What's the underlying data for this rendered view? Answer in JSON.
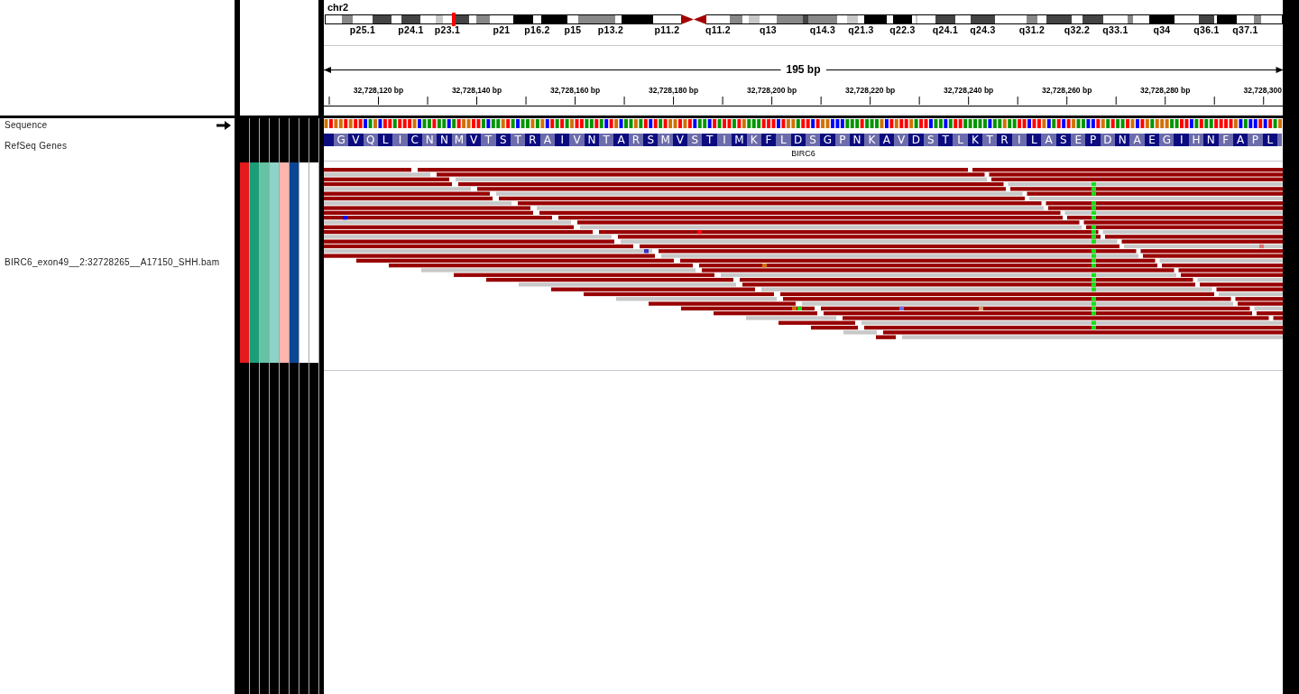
{
  "ideogram": {
    "chromosome": "chr2",
    "bands": [
      {
        "kind": "band",
        "color": "#ffffff"
      },
      {
        "kind": "band",
        "color": "#888888"
      },
      {
        "kind": "band",
        "color": "#ffffff",
        "label": "p25.1"
      },
      {
        "kind": "band",
        "color": "#444444"
      },
      {
        "kind": "band",
        "color": "#ffffff"
      },
      {
        "kind": "band",
        "color": "#444444",
        "label": "p24.1"
      },
      {
        "kind": "band",
        "color": "#ffffff"
      },
      {
        "kind": "band",
        "color": "#c8c8c8"
      },
      {
        "kind": "band",
        "color": "#ffffff",
        "label": "p23.1"
      },
      {
        "kind": "marker",
        "color": "#ff0000"
      },
      {
        "kind": "band",
        "color": "#444444"
      },
      {
        "kind": "band",
        "color": "#ffffff"
      },
      {
        "kind": "band",
        "color": "#888888"
      },
      {
        "kind": "band",
        "color": "#ffffff",
        "label": "p21"
      },
      {
        "kind": "band",
        "color": "#000000"
      },
      {
        "kind": "band",
        "color": "#ffffff",
        "label": "p16.2"
      },
      {
        "kind": "band",
        "color": "#000000"
      },
      {
        "kind": "band",
        "color": "#ffffff",
        "label": "p15"
      },
      {
        "kind": "band",
        "color": "#888888"
      },
      {
        "kind": "band",
        "color": "#888888",
        "label": "p13.2"
      },
      {
        "kind": "band",
        "color": "#ffffff"
      },
      {
        "kind": "band",
        "color": "#000000"
      },
      {
        "kind": "band",
        "color": "#ffffff",
        "label": "p11.2"
      },
      {
        "kind": "centromere",
        "color": "#a50000"
      },
      {
        "kind": "centromere",
        "color": "#a50000"
      },
      {
        "kind": "band",
        "color": "#ffffff",
        "label": "q11.2"
      },
      {
        "kind": "band",
        "color": "#888888"
      },
      {
        "kind": "band",
        "color": "#ffffff"
      },
      {
        "kind": "band",
        "color": "#c8c8c8"
      },
      {
        "kind": "band",
        "color": "#ffffff",
        "label": "q13"
      },
      {
        "kind": "band",
        "color": "#888888"
      },
      {
        "kind": "band",
        "color": "#444444"
      },
      {
        "kind": "band",
        "color": "#888888",
        "label": "q14.3"
      },
      {
        "kind": "band",
        "color": "#ffffff"
      },
      {
        "kind": "band",
        "color": "#c8c8c8"
      },
      {
        "kind": "band",
        "color": "#ffffff",
        "label": "q21.3"
      },
      {
        "kind": "band",
        "color": "#000000"
      },
      {
        "kind": "band",
        "color": "#ffffff"
      },
      {
        "kind": "band",
        "color": "#000000",
        "label": "q22.3"
      },
      {
        "kind": "band",
        "color": "#ffffff"
      },
      {
        "kind": "band",
        "color": "#c8c8c8"
      },
      {
        "kind": "band",
        "color": "#ffffff"
      },
      {
        "kind": "band",
        "color": "#444444",
        "label": "q24.1"
      },
      {
        "kind": "band",
        "color": "#ffffff"
      },
      {
        "kind": "band",
        "color": "#444444",
        "label": "q24.3"
      },
      {
        "kind": "band",
        "color": "#ffffff"
      },
      {
        "kind": "band",
        "color": "#888888",
        "label": "q31.2"
      },
      {
        "kind": "band",
        "color": "#ffffff"
      },
      {
        "kind": "band",
        "color": "#444444"
      },
      {
        "kind": "band",
        "color": "#ffffff",
        "label": "q32.2"
      },
      {
        "kind": "band",
        "color": "#444444"
      },
      {
        "kind": "band",
        "color": "#ffffff",
        "label": "q33.1"
      },
      {
        "kind": "band",
        "color": "#888888"
      },
      {
        "kind": "band",
        "color": "#ffffff"
      },
      {
        "kind": "band",
        "color": "#000000",
        "label": "q34"
      },
      {
        "kind": "band",
        "color": "#ffffff"
      },
      {
        "kind": "band",
        "color": "#444444",
        "label": "q36.1"
      },
      {
        "kind": "band",
        "color": "#ffffff"
      },
      {
        "kind": "band",
        "color": "#000000"
      },
      {
        "kind": "band",
        "color": "#ffffff",
        "label": "q37.1"
      },
      {
        "kind": "band",
        "color": "#888888"
      },
      {
        "kind": "band",
        "color": "#ffffff"
      }
    ]
  },
  "ruler": {
    "span": "195 bp",
    "tick_labels": [
      "32,728,120 bp",
      "32,728,140 bp",
      "32,728,160 bp",
      "32,728,180 bp",
      "32,728,200 bp",
      "32,728,220 bp",
      "32,728,240 bp",
      "32,728,260 bp",
      "32,728,280 bp",
      "32,728,300"
    ]
  },
  "tracks": [
    {
      "kind": "sequence",
      "name": "Sequence",
      "forward_strand": true,
      "bases": [
        {
          "color": "#d17105"
        },
        {
          "color": "#ff0000"
        },
        {
          "color": "#d17105"
        },
        {
          "color": "#d17105"
        },
        {
          "color": "#ff0000"
        },
        {
          "color": "#d17105"
        },
        {
          "color": "#ff0000"
        },
        {
          "color": "#ff0000"
        },
        {
          "color": "#0000ff"
        },
        {
          "color": "#009600"
        },
        {
          "color": "#d17105"
        },
        {
          "color": "#0000ff"
        },
        {
          "color": "#ff0000"
        },
        {
          "color": "#ff0000"
        },
        {
          "color": "#009600"
        },
        {
          "color": "#ff0000"
        },
        {
          "color": "#ff0000"
        },
        {
          "color": "#ff0000"
        },
        {
          "color": "#d17105"
        },
        {
          "color": "#0000ff"
        },
        {
          "color": "#009600"
        },
        {
          "color": "#009600"
        },
        {
          "color": "#ff0000"
        },
        {
          "color": "#009600"
        },
        {
          "color": "#009600"
        },
        {
          "color": "#0000ff"
        },
        {
          "color": "#009600"
        },
        {
          "color": "#ff0000"
        },
        {
          "color": "#d17105"
        },
        {
          "color": "#d17105"
        },
        {
          "color": "#ff0000"
        },
        {
          "color": "#ff0000"
        },
        {
          "color": "#009600"
        },
        {
          "color": "#0000ff"
        },
        {
          "color": "#009600"
        },
        {
          "color": "#009600"
        },
        {
          "color": "#d17105"
        },
        {
          "color": "#ff0000"
        },
        {
          "color": "#009600"
        },
        {
          "color": "#0000ff"
        },
        {
          "color": "#009600"
        },
        {
          "color": "#009600"
        },
        {
          "color": "#d17105"
        },
        {
          "color": "#009600"
        },
        {
          "color": "#d17105"
        },
        {
          "color": "#0000ff"
        },
        {
          "color": "#ff0000"
        },
        {
          "color": "#009600"
        },
        {
          "color": "#ff0000"
        },
        {
          "color": "#009600"
        },
        {
          "color": "#d17105"
        },
        {
          "color": "#ff0000"
        },
        {
          "color": "#ff0000"
        },
        {
          "color": "#009600"
        },
        {
          "color": "#009600"
        },
        {
          "color": "#ff0000"
        },
        {
          "color": "#009600"
        },
        {
          "color": "#0000ff"
        },
        {
          "color": "#ff0000"
        },
        {
          "color": "#d17105"
        },
        {
          "color": "#0000ff"
        },
        {
          "color": "#009600"
        },
        {
          "color": "#009600"
        },
        {
          "color": "#d17105"
        },
        {
          "color": "#009600"
        },
        {
          "color": "#ff0000"
        },
        {
          "color": "#0000ff"
        },
        {
          "color": "#ff0000"
        },
        {
          "color": "#009600"
        },
        {
          "color": "#ff0000"
        },
        {
          "color": "#d17105"
        },
        {
          "color": "#d17105"
        },
        {
          "color": "#ff0000"
        },
        {
          "color": "#d17105"
        },
        {
          "color": "#ff0000"
        },
        {
          "color": "#0000ff"
        },
        {
          "color": "#009600"
        },
        {
          "color": "#009600"
        },
        {
          "color": "#0000ff"
        },
        {
          "color": "#ff0000"
        },
        {
          "color": "#009600"
        },
        {
          "color": "#ff0000"
        },
        {
          "color": "#ff0000"
        },
        {
          "color": "#009600"
        },
        {
          "color": "#ff0000"
        },
        {
          "color": "#d17105"
        },
        {
          "color": "#009600"
        },
        {
          "color": "#009600"
        },
        {
          "color": "#009600"
        },
        {
          "color": "#ff0000"
        },
        {
          "color": "#ff0000"
        },
        {
          "color": "#ff0000"
        },
        {
          "color": "#0000ff"
        },
        {
          "color": "#ff0000"
        },
        {
          "color": "#d17105"
        },
        {
          "color": "#d17105"
        },
        {
          "color": "#009600"
        },
        {
          "color": "#ff0000"
        },
        {
          "color": "#ff0000"
        },
        {
          "color": "#0000ff"
        },
        {
          "color": "#ff0000"
        },
        {
          "color": "#d17105"
        },
        {
          "color": "#d17105"
        },
        {
          "color": "#0000ff"
        },
        {
          "color": "#0000ff"
        },
        {
          "color": "#0000ff"
        },
        {
          "color": "#009600"
        },
        {
          "color": "#009600"
        },
        {
          "color": "#009600"
        },
        {
          "color": "#ff0000"
        },
        {
          "color": "#009600"
        },
        {
          "color": "#009600"
        },
        {
          "color": "#009600"
        },
        {
          "color": "#d17105"
        },
        {
          "color": "#0000ff"
        },
        {
          "color": "#ff0000"
        },
        {
          "color": "#d17105"
        },
        {
          "color": "#ff0000"
        },
        {
          "color": "#ff0000"
        },
        {
          "color": "#d17105"
        },
        {
          "color": "#009600"
        },
        {
          "color": "#ff0000"
        },
        {
          "color": "#ff0000"
        },
        {
          "color": "#0000ff"
        },
        {
          "color": "#009600"
        },
        {
          "color": "#009600"
        },
        {
          "color": "#0000ff"
        },
        {
          "color": "#009600"
        },
        {
          "color": "#ff0000"
        },
        {
          "color": "#ff0000"
        },
        {
          "color": "#009600"
        },
        {
          "color": "#009600"
        },
        {
          "color": "#009600"
        },
        {
          "color": "#009600"
        },
        {
          "color": "#009600"
        },
        {
          "color": "#0000ff"
        },
        {
          "color": "#009600"
        },
        {
          "color": "#009600"
        },
        {
          "color": "#d17105"
        },
        {
          "color": "#009600"
        },
        {
          "color": "#009600"
        },
        {
          "color": "#ff0000"
        },
        {
          "color": "#ff0000"
        },
        {
          "color": "#0000ff"
        },
        {
          "color": "#ff0000"
        },
        {
          "color": "#ff0000"
        },
        {
          "color": "#d17105"
        },
        {
          "color": "#0000ff"
        },
        {
          "color": "#009600"
        },
        {
          "color": "#ff0000"
        },
        {
          "color": "#0000ff"
        },
        {
          "color": "#ff0000"
        },
        {
          "color": "#d17105"
        },
        {
          "color": "#009600"
        },
        {
          "color": "#009600"
        },
        {
          "color": "#0000ff"
        },
        {
          "color": "#0000ff"
        },
        {
          "color": "#ff0000"
        },
        {
          "color": "#d17105"
        },
        {
          "color": "#009600"
        },
        {
          "color": "#ff0000"
        },
        {
          "color": "#009600"
        },
        {
          "color": "#009600"
        },
        {
          "color": "#ff0000"
        },
        {
          "color": "#d17105"
        },
        {
          "color": "#0000ff"
        },
        {
          "color": "#ff0000"
        },
        {
          "color": "#d17105"
        },
        {
          "color": "#009600"
        },
        {
          "color": "#d17105"
        },
        {
          "color": "#d17105"
        },
        {
          "color": "#d17105"
        },
        {
          "color": "#009600"
        },
        {
          "color": "#009600"
        },
        {
          "color": "#ff0000"
        },
        {
          "color": "#ff0000"
        },
        {
          "color": "#0000ff"
        },
        {
          "color": "#009600"
        },
        {
          "color": "#ff0000"
        },
        {
          "color": "#009600"
        },
        {
          "color": "#009600"
        },
        {
          "color": "#ff0000"
        },
        {
          "color": "#ff0000"
        },
        {
          "color": "#ff0000"
        },
        {
          "color": "#ff0000"
        },
        {
          "color": "#d17105"
        },
        {
          "color": "#0000ff"
        },
        {
          "color": "#009600"
        },
        {
          "color": "#0000ff"
        },
        {
          "color": "#0000ff"
        },
        {
          "color": "#ff0000"
        },
        {
          "color": "#0000ff"
        },
        {
          "color": "#ff0000"
        },
        {
          "color": "#009600"
        },
        {
          "color": "#d17105"
        }
      ]
    },
    {
      "kind": "gene",
      "name": "RefSeq Genes",
      "gene": "BIRC6",
      "amino_acids": [
        "G",
        "V",
        "Q",
        "L",
        "I",
        "C",
        "N",
        "N",
        "M",
        "V",
        "T",
        "S",
        "T",
        "R",
        "A",
        "I",
        "V",
        "N",
        "T",
        "A",
        "R",
        "S",
        "M",
        "V",
        "S",
        "T",
        "I",
        "M",
        "K",
        "F",
        "L",
        "D",
        "S",
        "G",
        "P",
        "N",
        "K",
        "A",
        "V",
        "D",
        "S",
        "T",
        "L",
        "K",
        "T",
        "R",
        "I",
        "L",
        "A",
        "S",
        "E",
        "P",
        "D",
        "N",
        "A",
        "E",
        "G",
        "I",
        "H",
        "N",
        "F",
        "A",
        "P",
        "L"
      ]
    },
    {
      "kind": "alignment",
      "name": "BIRC6_exon49__2:32728265__A17150_SHH.bam",
      "attributes": [
        {
          "color": "#e41a1c"
        },
        {
          "color": "#1b9e77"
        },
        {
          "color": "#66c2a5"
        },
        {
          "color": "#8dd3c7"
        },
        {
          "color": "#fbb4ae"
        },
        {
          "color": "#0b4695"
        },
        {
          "color": "#ffffff"
        },
        {
          "color": "#ffffff"
        }
      ]
    }
  ]
}
